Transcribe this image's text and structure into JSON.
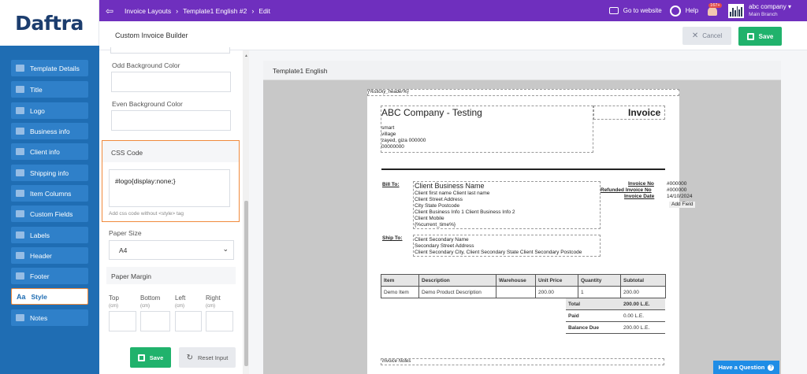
{
  "brand": {
    "logo_text": "Daftra"
  },
  "topbar": {
    "breadcrumbs": [
      "Invoice Layouts",
      "Template1 English #2",
      "Edit"
    ],
    "go_to_website": "Go to website",
    "help": "Help",
    "notif_badge": "167+",
    "company_name": "abc company",
    "branch": "Main Branch"
  },
  "header": {
    "title": "Custom Invoice Builder",
    "cancel_label": "Cancel",
    "save_label": "Save"
  },
  "sidebar": {
    "items": [
      {
        "label": "Template Details",
        "icon": "gear-icon"
      },
      {
        "label": "Title",
        "icon": "title-icon"
      },
      {
        "label": "Logo",
        "icon": "image-icon"
      },
      {
        "label": "Business info",
        "icon": "briefcase-icon"
      },
      {
        "label": "Client info",
        "icon": "id-card-icon"
      },
      {
        "label": "Shipping info",
        "icon": "truck-icon"
      },
      {
        "label": "Item Columns",
        "icon": "list-icon"
      },
      {
        "label": "Custom Fields",
        "icon": "edit-icon"
      },
      {
        "label": "Labels",
        "icon": "tag-icon"
      },
      {
        "label": "Header",
        "icon": "header-icon"
      },
      {
        "label": "Footer",
        "icon": "footer-icon"
      },
      {
        "label": "Style",
        "icon": "text-style-icon",
        "glyph": "Aa"
      },
      {
        "label": "Notes",
        "icon": "notes-icon"
      }
    ],
    "active": "Style"
  },
  "panel": {
    "odd_bg_label": "Odd Background Color",
    "even_bg_label": "Even Background Color",
    "css_title": "CSS Code",
    "css_value": "#logo{display:none;}",
    "css_hint": "Add css code without <style> tag",
    "paper_size_label": "Paper Size",
    "paper_size_value": "A4",
    "paper_margin_label": "Paper Margin",
    "margins": [
      {
        "label": "Top",
        "unit": "(cm)"
      },
      {
        "label": "Bottom",
        "unit": "(cm)"
      },
      {
        "label": "Left",
        "unit": "(cm)"
      },
      {
        "label": "Right",
        "unit": "(cm)"
      }
    ],
    "save_label": "Save",
    "reset_label": "Reset Input"
  },
  "preview": {
    "title": "Template1 English",
    "sticky_header": "{%sticky_header%}",
    "company": "ABC Company - Testing",
    "doc_title": "Invoice",
    "address": [
      "smart",
      "village",
      "zayed, giza 000000",
      "00000000"
    ],
    "bill_to_label": "Bill To:",
    "client_name": "Client Business Name",
    "client_lines": [
      "Client first name Client last name",
      "Client Street Address",
      "City State Postcode",
      "Client Business Info 1 Client Business Info 2",
      "Client Mobile",
      "{%current_time%}"
    ],
    "meta": [
      {
        "label": "Invoice No",
        "value": "#000000"
      },
      {
        "label": "Refunded Invoice No",
        "value": "#000000"
      },
      {
        "label": "Invoice Date",
        "value": "14/10/2024"
      }
    ],
    "add_field": "Add Field",
    "ship_to_label": "Ship To:",
    "ship_lines": [
      "Client Secondary Name",
      "Secondary Street Address",
      "Client Secondary City, Client Secondary State Client Secondary Postcode"
    ],
    "table_headers": [
      "Item",
      "Description",
      "Warehouse",
      "Unit Price",
      "Quantity",
      "Subtotal"
    ],
    "table_row": [
      "Demo Item",
      "Demo Product Description",
      "",
      "200.00",
      "1",
      "200.00"
    ],
    "totals": [
      {
        "label": "Total",
        "value": "200.00 L.E."
      },
      {
        "label": "Paid",
        "value": "0.00 L.E."
      },
      {
        "label": "Balance Due",
        "value": "200.00 L.E."
      }
    ],
    "invoice_notes": "Invoice Notes"
  },
  "help_widget": {
    "label": "Have a Question",
    "glyph": "?"
  }
}
